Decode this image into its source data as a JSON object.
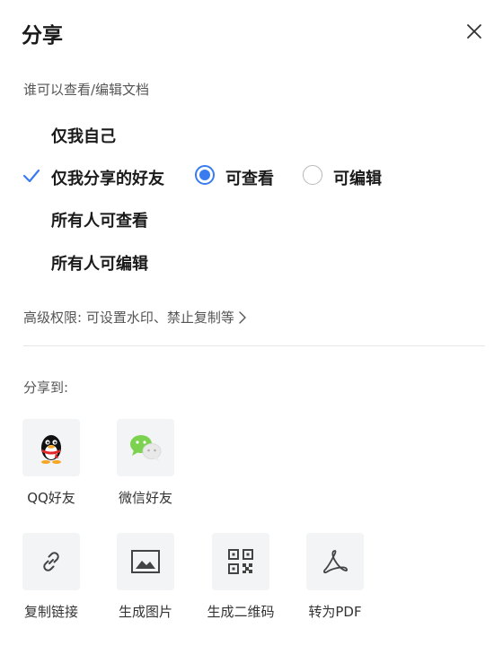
{
  "header": {
    "title": "分享",
    "close_icon": "close-icon"
  },
  "permissions": {
    "label": "谁可以查看/编辑文档",
    "options": [
      {
        "label": "仅我自己",
        "selected": false
      },
      {
        "label": "仅我分享的好友",
        "selected": true
      },
      {
        "label": "所有人可查看",
        "selected": false
      },
      {
        "label": "所有人可编辑",
        "selected": false
      }
    ],
    "access_modes": [
      {
        "label": "可查看",
        "selected": true
      },
      {
        "label": "可编辑",
        "selected": false
      }
    ],
    "accent_color": "#3a7bf0"
  },
  "advanced": {
    "label": "高级权限: 可设置水印、禁止复制等"
  },
  "share_to": {
    "label": "分享到:",
    "targets": [
      {
        "label": "QQ好友",
        "icon": "qq-icon"
      },
      {
        "label": "微信好友",
        "icon": "wechat-icon"
      }
    ],
    "actions": [
      {
        "label": "复制链接",
        "icon": "link-icon"
      },
      {
        "label": "生成图片",
        "icon": "image-icon"
      },
      {
        "label": "生成二维码",
        "icon": "qrcode-icon"
      },
      {
        "label": "转为PDF",
        "icon": "pdf-icon"
      }
    ]
  }
}
